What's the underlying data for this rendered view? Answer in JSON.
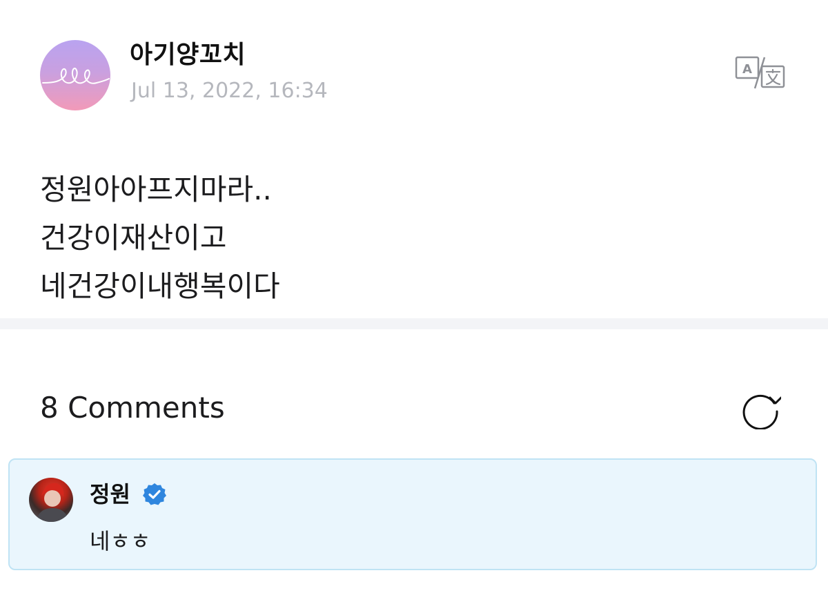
{
  "post": {
    "author_name": "아기양꼬치",
    "date": "Jul 13, 2022, 16:34",
    "translate_icon": "translate-icon",
    "body_lines": [
      "정원아아프지마라..",
      "건강이재산이고",
      "네건강이내행복이다"
    ]
  },
  "comments": {
    "title": "8 Comments",
    "refresh_icon": "refresh-icon",
    "items": [
      {
        "author": "정원",
        "verified": true,
        "text": "네ㅎㅎ"
      }
    ]
  },
  "colors": {
    "comment_bg": "#eaf6fd",
    "comment_border": "#bfe3f4",
    "verified_blue": "#2f86de",
    "date_gray": "#b5b7bd"
  }
}
